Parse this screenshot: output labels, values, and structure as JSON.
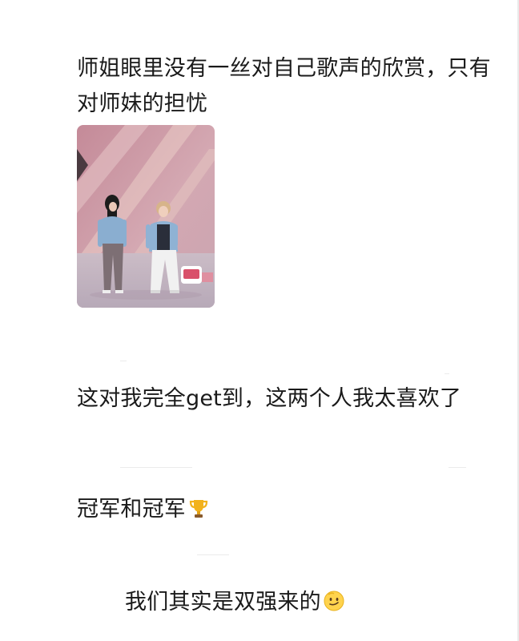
{
  "post": {
    "paragraph_1": "师姐眼里没有一丝对自己歌声的欣赏，只有对师妹的担忧",
    "paragraph_2": "这对我完全get到，这两个人我太喜欢了",
    "paragraph_3": "冠军和冠军",
    "paragraph_3_emoji": "trophy-icon",
    "paragraph_4": "我们其实是双强来的",
    "paragraph_4_emoji": "slight-smile-face-icon"
  },
  "photo": {
    "description_icon": "stage-photo-two-performers",
    "accent_color": "#d9506a",
    "background_color": "#c99aa4"
  }
}
